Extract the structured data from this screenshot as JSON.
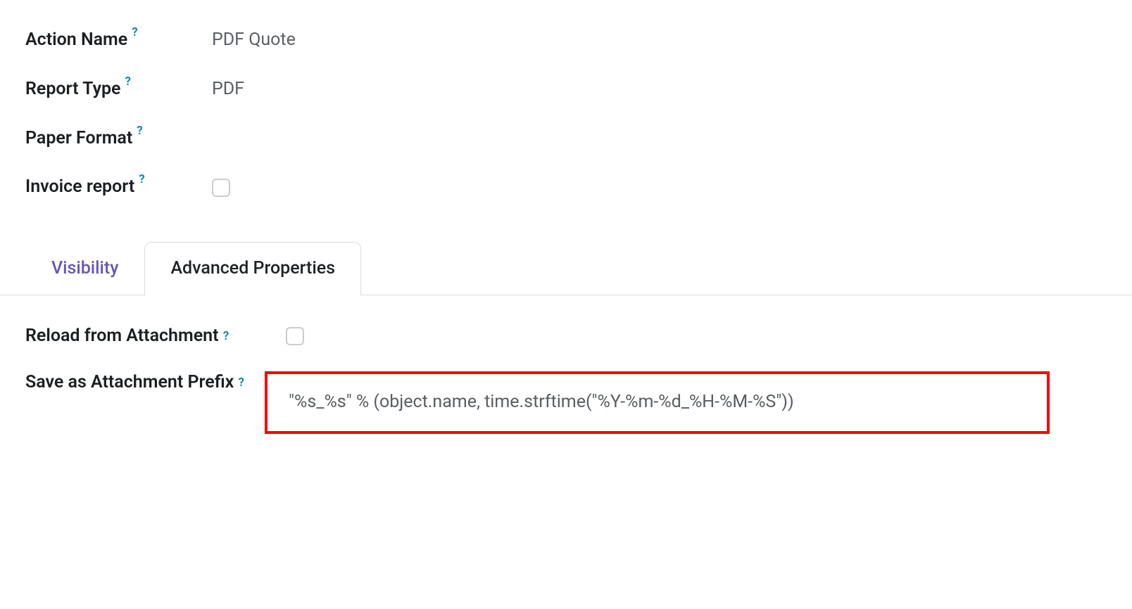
{
  "fields": {
    "action_name": {
      "label": "Action Name",
      "value": "PDF Quote"
    },
    "report_type": {
      "label": "Report Type",
      "value": "PDF"
    },
    "paper_format": {
      "label": "Paper Format",
      "value": ""
    },
    "invoice_report": {
      "label": "Invoice report"
    }
  },
  "tabs": {
    "visibility": "Visibility",
    "advanced": "Advanced Properties"
  },
  "advanced": {
    "reload_from_attachment": {
      "label": "Reload from Attachment"
    },
    "save_as_attachment_prefix": {
      "label": "Save as Attachment Prefix",
      "value": "\"%s_%s\" % (object.name, time.strftime(\"%Y-%m-%d_%H-%M-%S\"))"
    }
  },
  "help_glyph": "?"
}
